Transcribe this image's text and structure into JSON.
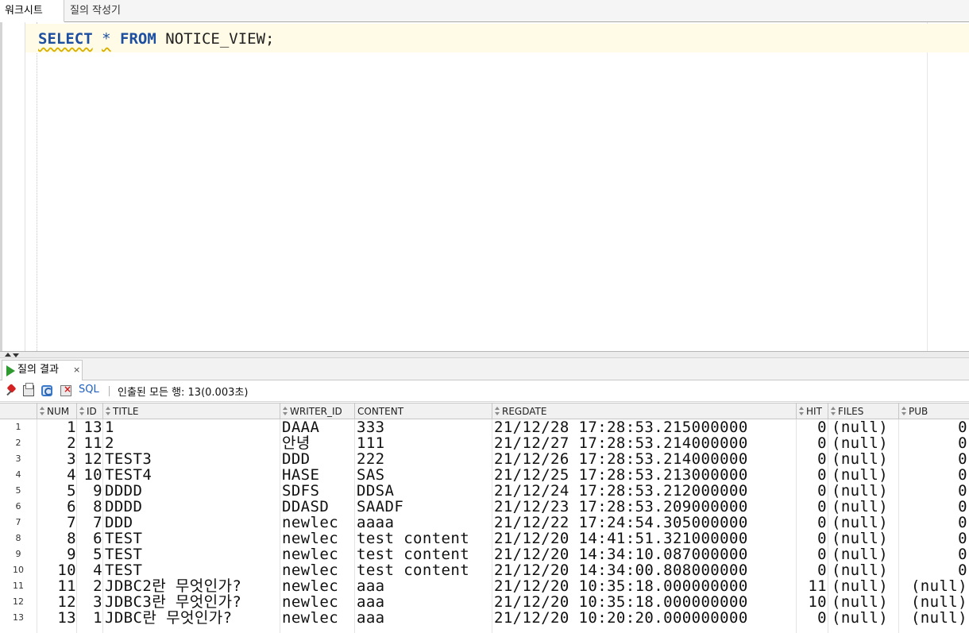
{
  "top_tabs": [
    "워크시트",
    "질의 작성기"
  ],
  "editor": {
    "kw_select": "SELECT",
    "star": "*",
    "kw_from": "FROM",
    "object": "NOTICE_VIEW;"
  },
  "result_tab": {
    "label": "질의 결과",
    "close": "×"
  },
  "toolbar": {
    "sql_label": "SQL",
    "status": "인출된 모든 행: 13(0.003초)"
  },
  "grid": {
    "columns": [
      "NUM",
      "ID",
      "TITLE",
      "WRITER_ID",
      "CONTENT",
      "REGDATE",
      "HIT",
      "FILES",
      "PUB"
    ],
    "rows": [
      [
        "1",
        "13",
        "1",
        "DAAA",
        "333",
        "21/12/28 17:28:53.215000000",
        "0",
        "(null)",
        "0"
      ],
      [
        "2",
        "11",
        "2",
        "안녕",
        "111",
        "21/12/27 17:28:53.214000000",
        "0",
        "(null)",
        "0"
      ],
      [
        "3",
        "12",
        "TEST3",
        "DDD",
        "222",
        "21/12/26 17:28:53.214000000",
        "0",
        "(null)",
        "0"
      ],
      [
        "4",
        "10",
        "TEST4",
        "HASE",
        "SAS",
        "21/12/25 17:28:53.213000000",
        "0",
        "(null)",
        "0"
      ],
      [
        "5",
        "9",
        "DDDD",
        "SDFS",
        "DDSA",
        "21/12/24 17:28:53.212000000",
        "0",
        "(null)",
        "0"
      ],
      [
        "6",
        "8",
        "DDDD",
        "DDASD",
        "SAADF",
        "21/12/23 17:28:53.209000000",
        "0",
        "(null)",
        "0"
      ],
      [
        "7",
        "7",
        "DDD",
        "newlec",
        "aaaa",
        "21/12/22 17:24:54.305000000",
        "0",
        "(null)",
        "0"
      ],
      [
        "8",
        "6",
        "TEST",
        "newlec",
        "test content",
        "21/12/20 14:41:51.321000000",
        "0",
        "(null)",
        "0"
      ],
      [
        "9",
        "5",
        "TEST",
        "newlec",
        "test content",
        "21/12/20 14:34:10.087000000",
        "0",
        "(null)",
        "0"
      ],
      [
        "10",
        "4",
        "TEST",
        "newlec",
        "test content",
        "21/12/20 14:34:00.808000000",
        "0",
        "(null)",
        "0"
      ],
      [
        "11",
        "2",
        "JDBC2란 무엇인가?",
        "newlec",
        "aaa",
        "21/12/20 10:35:18.000000000",
        "11",
        "(null)",
        "(null)"
      ],
      [
        "12",
        "3",
        "JDBC3란 무엇인가?",
        "newlec",
        "aaa",
        "21/12/20 10:35:18.000000000",
        "10",
        "(null)",
        "(null)"
      ],
      [
        "13",
        "1",
        "JDBC란 무엇인가?",
        "newlec",
        "aaa",
        "21/12/20 10:20:20.000000000",
        "0",
        "(null)",
        "(null)"
      ]
    ]
  }
}
